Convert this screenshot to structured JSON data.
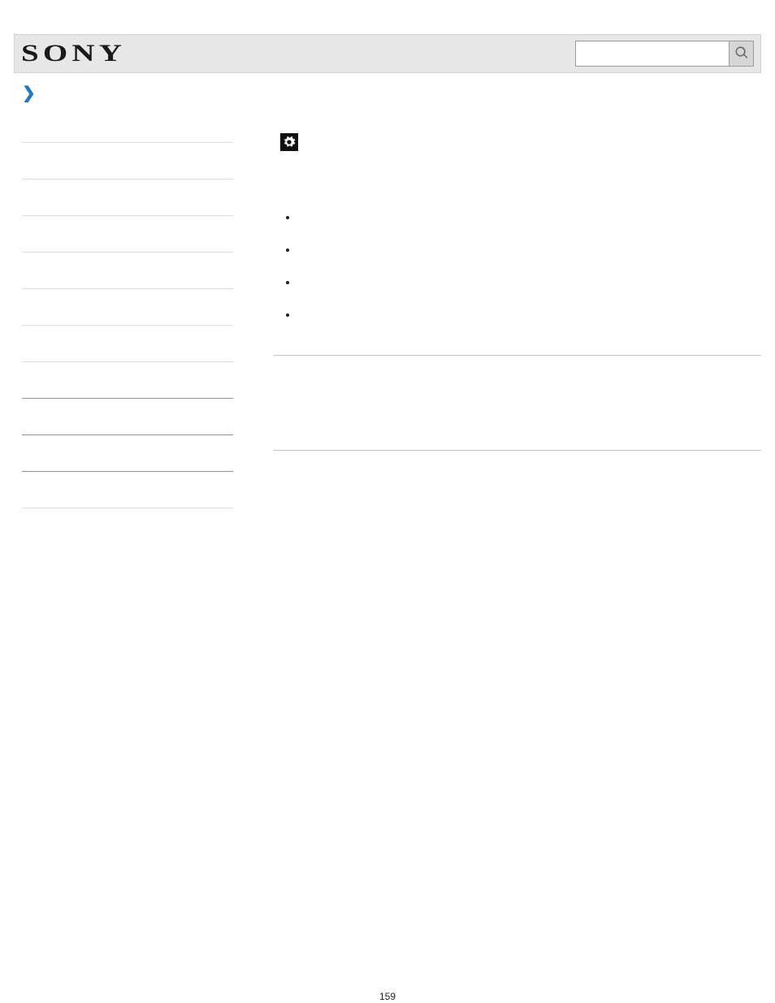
{
  "header": {
    "brand": "SONY",
    "search_placeholder": ""
  },
  "sidebar": {
    "items": [
      {
        "label": ""
      },
      {
        "label": ""
      },
      {
        "label": ""
      },
      {
        "label": ""
      },
      {
        "label": ""
      },
      {
        "label": ""
      },
      {
        "label": ""
      },
      {
        "label": ""
      },
      {
        "label": ""
      },
      {
        "label": ""
      },
      {
        "label": ""
      }
    ]
  },
  "main": {
    "instruction_prefix": "",
    "instruction_suffix": "",
    "bullets": [
      "",
      "",
      "",
      ""
    ],
    "note_heading": "",
    "note_body": ""
  },
  "page_number": "159"
}
